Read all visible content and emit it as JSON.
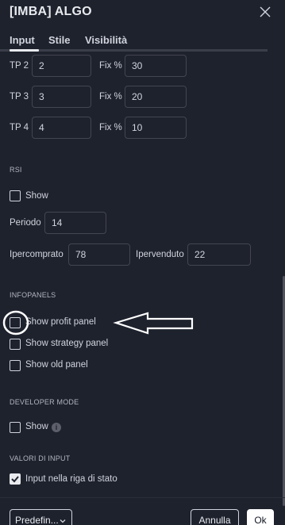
{
  "dialog": {
    "title": "[IMBA] ALGO"
  },
  "tabs": [
    {
      "label": "Input"
    },
    {
      "label": "Stile"
    },
    {
      "label": "Visibilità"
    }
  ],
  "tp_rows": [
    {
      "label": "TP 2",
      "value": "2",
      "fix_label": "Fix %",
      "fix_value": "30"
    },
    {
      "label": "TP 3",
      "value": "3",
      "fix_label": "Fix %",
      "fix_value": "20"
    },
    {
      "label": "TP 4",
      "value": "4",
      "fix_label": "Fix %",
      "fix_value": "10"
    }
  ],
  "rsi": {
    "section": "RSI",
    "show_label": "Show",
    "show_checked": false,
    "periodo_label": "Periodo",
    "periodo_value": "14",
    "ipercomprato_label": "Ipercomprato",
    "ipercomprato_value": "78",
    "ipervenduto_label": "Ipervenduto",
    "ipervenduto_value": "22"
  },
  "infopanels": {
    "section": "INFOPANELS",
    "items": [
      {
        "label": "Show profit panel",
        "checked": false
      },
      {
        "label": "Show strategy panel",
        "checked": false
      },
      {
        "label": "Show old panel",
        "checked": false
      }
    ]
  },
  "developer": {
    "section": "DEVELOPER MODE",
    "show_label": "Show",
    "show_checked": false
  },
  "valori": {
    "section": "VALORI DI INPUT",
    "status_label": "Input nella riga di stato",
    "status_checked": true
  },
  "footer": {
    "preset_label": "Predefin...",
    "cancel_label": "Annulla",
    "ok_label": "Ok"
  },
  "colors": {
    "background": "#1e222d",
    "text": "#d1d4dc",
    "input_border": "#434651",
    "annotation": "#ffffff"
  },
  "icons": [
    "close-icon",
    "info-icon",
    "checkmark-icon",
    "chevron-down-icon",
    "arrow-annotation-icon"
  ]
}
